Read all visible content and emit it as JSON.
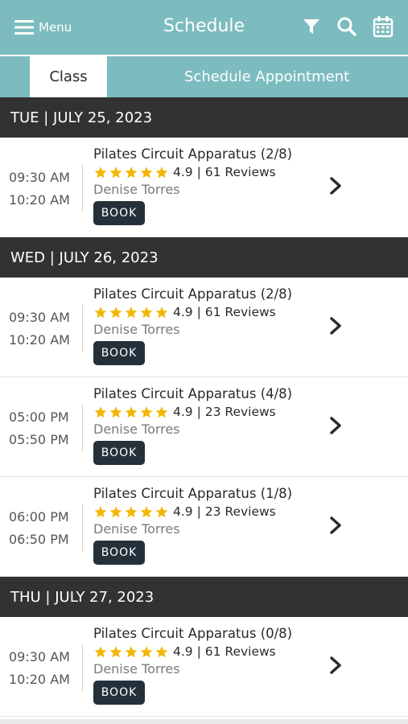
{
  "header": {
    "menu_label": "Menu",
    "title": "Schedule",
    "icons": [
      "menu-icon",
      "filter-icon",
      "search-icon",
      "calendar-icon"
    ],
    "accent_color": "#7cbcbf"
  },
  "tabs": [
    {
      "label": "Class",
      "active": true
    },
    {
      "label": "Schedule Appointment",
      "active": false
    }
  ],
  "days": [
    {
      "date": "TUE | JULY 25, 2023",
      "classes": [
        {
          "start": "09:30 AM",
          "end": "10:20 AM",
          "name": "Pilates Circuit Apparatus (2/8)",
          "rating": "4.9 | 61 Reviews",
          "instructor": "Denise Torres",
          "book": "BOOK"
        }
      ]
    },
    {
      "date": "WED | JULY 26, 2023",
      "classes": [
        {
          "start": "09:30 AM",
          "end": "10:20 AM",
          "name": "Pilates Circuit Apparatus (2/8)",
          "rating": "4.9 | 61 Reviews",
          "instructor": "Denise Torres",
          "book": "BOOK"
        },
        {
          "start": "05:00 PM",
          "end": "05:50 PM",
          "name": "Pilates Circuit Apparatus (4/8)",
          "rating": "4.9 | 23 Reviews",
          "instructor": "Denise Torres",
          "book": "BOOK"
        },
        {
          "start": "06:00 PM",
          "end": "06:50 PM",
          "name": "Pilates Circuit Apparatus (1/8)",
          "rating": "4.9 | 23 Reviews",
          "instructor": "Denise Torres",
          "book": "BOOK"
        }
      ]
    },
    {
      "date": "THU | JULY 27, 2023",
      "classes": [
        {
          "start": "09:30 AM",
          "end": "10:20 AM",
          "name": "Pilates Circuit Apparatus (0/8)",
          "rating": "4.9 | 61 Reviews",
          "instructor": "Denise Torres",
          "book": "BOOK"
        }
      ]
    }
  ],
  "star_color": "#f2b705",
  "star_count": 5
}
